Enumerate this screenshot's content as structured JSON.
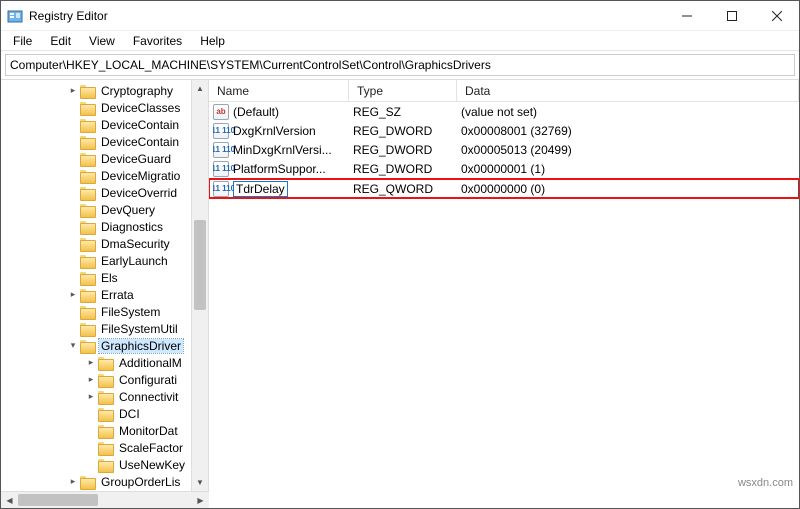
{
  "window": {
    "title": "Registry Editor"
  },
  "menu": {
    "file": "File",
    "edit": "Edit",
    "view": "View",
    "favorites": "Favorites",
    "help": "Help"
  },
  "address": "Computer\\HKEY_LOCAL_MACHINE\\SYSTEM\\CurrentControlSet\\Control\\GraphicsDrivers",
  "tree": [
    {
      "depth": 0,
      "exp": "closed",
      "label": "Cryptography"
    },
    {
      "depth": 0,
      "exp": "none",
      "label": "DeviceClasses"
    },
    {
      "depth": 0,
      "exp": "none",
      "label": "DeviceContain"
    },
    {
      "depth": 0,
      "exp": "none",
      "label": "DeviceContain"
    },
    {
      "depth": 0,
      "exp": "none",
      "label": "DeviceGuard"
    },
    {
      "depth": 0,
      "exp": "none",
      "label": "DeviceMigratio"
    },
    {
      "depth": 0,
      "exp": "none",
      "label": "DeviceOverrid"
    },
    {
      "depth": 0,
      "exp": "none",
      "label": "DevQuery"
    },
    {
      "depth": 0,
      "exp": "none",
      "label": "Diagnostics"
    },
    {
      "depth": 0,
      "exp": "none",
      "label": "DmaSecurity"
    },
    {
      "depth": 0,
      "exp": "none",
      "label": "EarlyLaunch"
    },
    {
      "depth": 0,
      "exp": "none",
      "label": "Els"
    },
    {
      "depth": 0,
      "exp": "closed",
      "label": "Errata"
    },
    {
      "depth": 0,
      "exp": "none",
      "label": "FileSystem"
    },
    {
      "depth": 0,
      "exp": "none",
      "label": "FileSystemUtil"
    },
    {
      "depth": 0,
      "exp": "open",
      "label": "GraphicsDriver",
      "selected": true
    },
    {
      "depth": 1,
      "exp": "closed",
      "label": "AdditionalM"
    },
    {
      "depth": 1,
      "exp": "closed",
      "label": "Configurati"
    },
    {
      "depth": 1,
      "exp": "closed",
      "label": "Connectivit"
    },
    {
      "depth": 1,
      "exp": "none",
      "label": "DCI"
    },
    {
      "depth": 1,
      "exp": "none",
      "label": "MonitorDat"
    },
    {
      "depth": 1,
      "exp": "none",
      "label": "ScaleFactor"
    },
    {
      "depth": 1,
      "exp": "none",
      "label": "UseNewKey"
    },
    {
      "depth": 0,
      "exp": "closed",
      "label": "GroupOrderLis"
    }
  ],
  "columns": {
    "name": "Name",
    "type": "Type",
    "data": "Data"
  },
  "values": [
    {
      "icon": "sz",
      "name": "(Default)",
      "type": "REG_SZ",
      "data": "(value not set)",
      "renaming": false,
      "highlight": false
    },
    {
      "icon": "bin",
      "name": "DxgKrnlVersion",
      "type": "REG_DWORD",
      "data": "0x00008001 (32769)",
      "renaming": false,
      "highlight": false
    },
    {
      "icon": "bin",
      "name": "MinDxgKrnlVersi...",
      "type": "REG_DWORD",
      "data": "0x00005013 (20499)",
      "renaming": false,
      "highlight": false
    },
    {
      "icon": "bin",
      "name": "PlatformSuppor...",
      "type": "REG_DWORD",
      "data": "0x00000001 (1)",
      "renaming": false,
      "highlight": false
    },
    {
      "icon": "bin",
      "name": "TdrDelay",
      "type": "REG_QWORD",
      "data": "0x00000000 (0)",
      "renaming": true,
      "highlight": true
    }
  ],
  "icon_glyph": {
    "sz": "ab",
    "bin": "011 110"
  },
  "watermark": "wsxdn.com"
}
